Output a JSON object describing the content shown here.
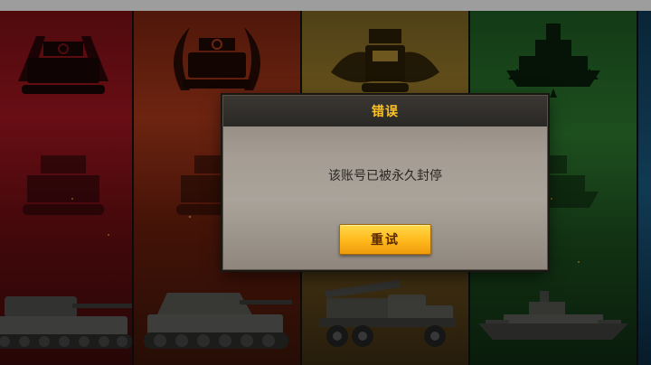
{
  "dialog": {
    "title": "错误",
    "message": "该账号已被永久封停",
    "retry_label": "重试"
  },
  "panels": [
    {
      "name": "german-heavy-tank",
      "accent": "#a01620"
    },
    {
      "name": "tank-destroyer",
      "accent": "#a8381a"
    },
    {
      "name": "rocket-artillery-truck",
      "accent": "#a8862e"
    },
    {
      "name": "battleship",
      "accent": "#2e7a30"
    },
    {
      "name": "partial-panel",
      "accent": "#1a5a80"
    }
  ]
}
